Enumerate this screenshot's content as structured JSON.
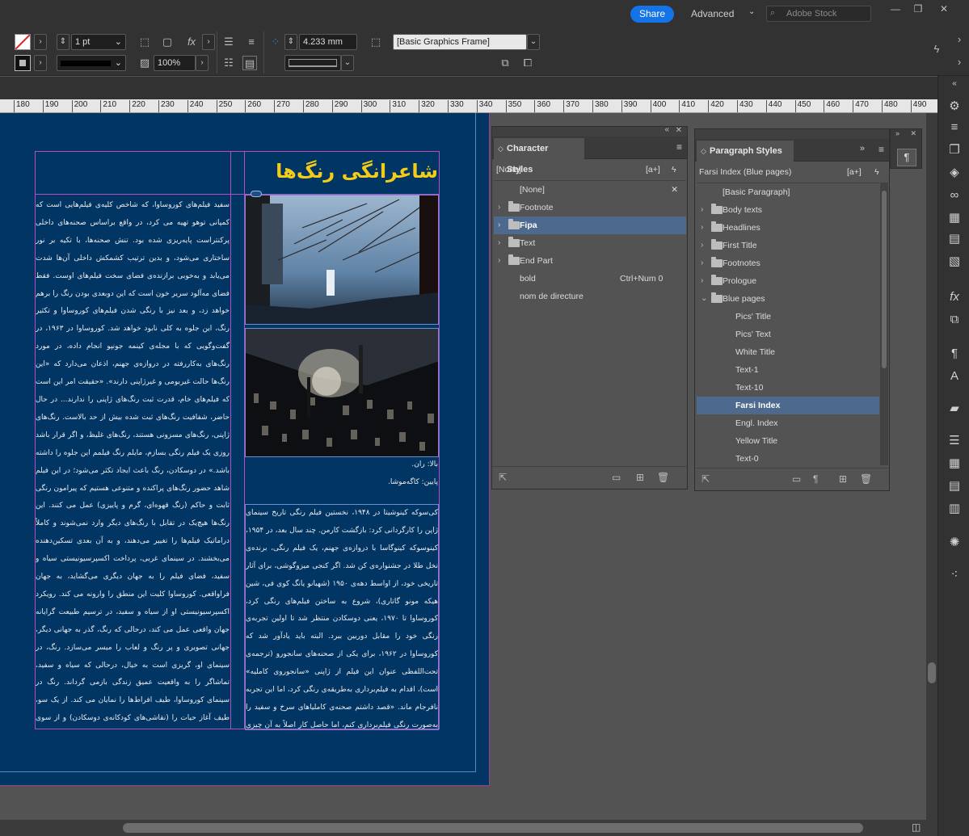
{
  "appbar": {
    "share_label": "Share",
    "workspace_label": "Advanced",
    "stock_placeholder": "Adobe Stock"
  },
  "control": {
    "stroke_weight": "1 pt",
    "opacity": "100%",
    "ref_value": "4.233 mm",
    "object_style": "[Basic Graphics Frame]"
  },
  "ruler": {
    "ticks": [
      "180",
      "190",
      "200",
      "210",
      "220",
      "230",
      "240",
      "250",
      "260",
      "270",
      "280",
      "290",
      "300",
      "310",
      "320",
      "330",
      "340",
      "350",
      "360",
      "370",
      "380",
      "390",
      "400",
      "410",
      "420",
      "430",
      "440",
      "450",
      "460",
      "470",
      "480",
      "490"
    ]
  },
  "document": {
    "title": "شاعرانگی رنگ‌ها",
    "left_column": "سفید فیلم‌های کوروساوا، که شاخص کلیه‌ی فیلم‌هایی است که کمپانی توهو تهیه می کرد، در واقع براساس صحنه‌های داخلی پرکنتراست پایه‌ریزی شده بود. تنش صحنه‌ها، با تکیه بر نور ساختاری می‌شود، و بدین ترتیب کشمکش داخلی آن‌ها شدت می‌یابد و به‌خوبی برازنده‌ی فضای سخت فیلم‌های اوست. فقط فضای مه‌آلود سریر خون است که این دوبعدی بودن رنگ را برهم خواهد زد، و بعد نیز با رنگی شدن فیلم‌های کوروساوا و تکثیر رنگ، این جلوه به کلی نابود خواهد شد. کوروساوا در ۱۹۶۳، در گفت‌وگویی که با مجله‌ی کینمه جونپو انجام داده، در مورد رنگ‌های به‌کاررفته در دروازه‌ی جهنم، اذعان می‌دارد که «این رنگ‌ها حالت غیربومی و غیرژاپنی دارند». «حقیقت امر این است که فیلم‌های خام، قدرت ثبت رنگ‌های ژاپنی را ندارند... در حال حاضر، شفافیت رنگ‌های ثبت شده بیش از حد بالاست. رنگ‌های ژاپنی، رنگ‌های مسزونی هستند، رنگ‌های غلیظ، و اگر قرار باشد روزی یک فیلم رنگی بسازم، مایلم رنگ فیلمم این جلوه را داشته باشد.» در دوسکادن، رنگ باعث ایجاد تکثر می‌شود؛ در این فیلم شاهد حضور رنگ‌های پراکنده و متنوعی هستیم که پیرامون رنگی ثابت و حاکم (رنگ قهوه‌ای، گرم و پاییزی) عمل می کنند. این رنگ‌ها هیچ‌یک در تقابل با رنگ‌های دیگر وارد نمی‌شوند و کاملاً دراماتیک فیلم‌ها را تغییر می‌دهند، و به آن بعدی تسکین‌دهنده می‌بخشند. در سینمای غربی، پرداخت اکسپرسیونیستی سیاه و سفید، فضای فیلم را به جهان دیگری می‌گشاید، به جهان فراواقعی. کوروساوا کلیت این منطق را وارونه می کند. رویکرد اکسپرسیونیستی او از سیاه و سفید، در ترسیم طبیعت گرایانه جهان واقعی عمل می کند، درحالی که رنگ، گذر به جهانی دیگر، جهانی تصویری و پر رنگ و لعاب را میسر می‌سازد. رنگ، در سینمای او، گریزی است به خیال، درحالی که سیاه و سفید، تماشاگر را به واقعیت عمیق زندگی بازمی گرداند. رنگ در سینمای کوروساوا، طیف افراط‌ها را نمایان می کند. از یک سو، طیف آغاز حیات را (نقاشی‌های کودکانه‌ی دوسکادن) و از سوی دیگر، طیف پایان زندگی را، با جهان مردگان، و تصویری جهنمی از آشوب و ویرانگر (کاگه‌موشا، ران، رؤیاها).",
    "right_column": "کی‌سوکه کینوشیتا در ۱۹۴۸، نخستین فیلم رنگی تاریخ سینمای ژاپن را کارگردانی کرد: بازگشت کارمن. چند سال بعد، در ۱۹۵۴، کینوسوکه کینوگاسا با دروازه‌ی جهنم، یک فیلم رنگی، برنده‌ی نخل طلا در جشنواره‌ی کن شد. اگر کنجی میزوگوشی، برای آثار تاریخی خود، از اواسط دهه‌ی ۱۹۵۰ (شهبانو یانگ کوی فی، شین هیکه مونو گاتاری)، شروع به ساختن فیلم‌های رنگی کرد، کوروساوا تا ۱۹۷۰، یعنی دوسکادن منتظر شد تا اولین تجربه‌ی رنگی خود را مقابل دوربین ببرد. البته باید یادآور شد که کوروساوا در ۱۹۶۲، برای یکی از صحنه‌های سانجورو (ترجمه‌ی تحت‌اللفظی عنوان این فیلم از ژاپنی «سانجوروی کاملیه» است)، اقدام به فیلم‌برداری به‌طریقه‌ی رنگی کرد، اما این تجربه نافرجام ماند. «قصد داشتم صحنه‌ی کاملیاهای سرخ و سفید را به‌صورت رنگی فیلم‌برداری کنم، اما حاصل کار اصلاً به آن چیزی که در ذهن داشتم، شبیه نشد و از این کار صرف‌نظر کردم.» سیاه و",
    "caption_top": "بالا: ران.",
    "caption_bottom": "پایین: کاگه‌موشا."
  },
  "character_styles": {
    "tab": "Character Styles",
    "current": "[None]",
    "rows": [
      {
        "label": "[None]"
      },
      {
        "label": "Footnote"
      },
      {
        "label": "Fipa"
      },
      {
        "label": "Text"
      },
      {
        "label": "End Part"
      },
      {
        "label": "bold",
        "shortcut": "Ctrl+Num 0"
      },
      {
        "label": "nom de directure"
      }
    ]
  },
  "paragraph_styles": {
    "tab": "Paragraph Styles",
    "current": "Farsi Index (Blue pages)",
    "rows": [
      {
        "label": "[Basic Paragraph]"
      },
      {
        "label": "Body texts"
      },
      {
        "label": "Headlines"
      },
      {
        "label": "First Title"
      },
      {
        "label": "Footnotes"
      },
      {
        "label": "Prologue"
      },
      {
        "label": "Blue pages"
      },
      {
        "label": "Pics' Title"
      },
      {
        "label": "Pics' Text"
      },
      {
        "label": "White Title"
      },
      {
        "label": "Text-1"
      },
      {
        "label": "Text-10"
      },
      {
        "label": "Farsi Index"
      },
      {
        "label": "Engl. Index"
      },
      {
        "label": "Yellow Title"
      },
      {
        "label": "Text-0"
      }
    ]
  }
}
